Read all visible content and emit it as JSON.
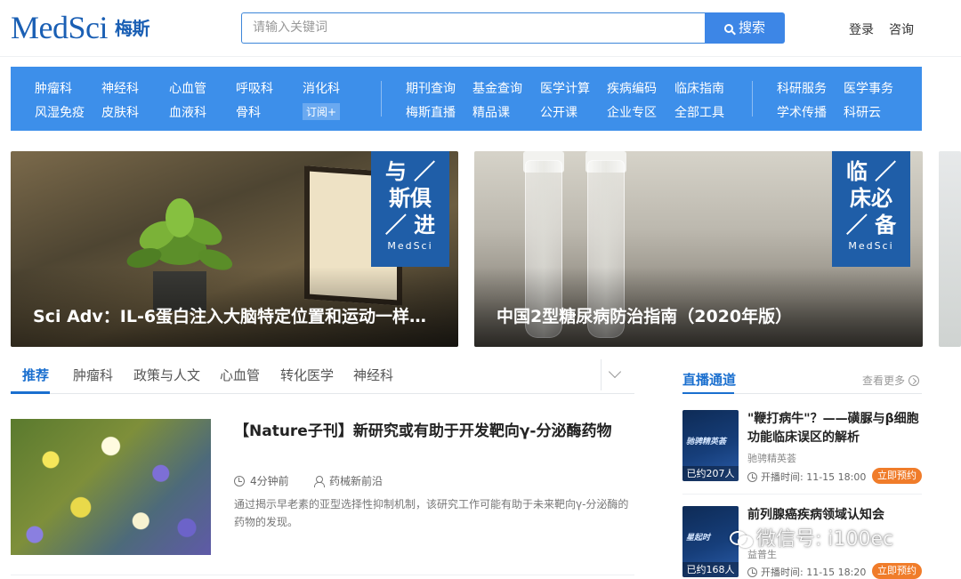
{
  "header": {
    "logo_text": "MedSci",
    "logo_cn": "梅斯",
    "search_placeholder": "请输入关键词",
    "search_button": "搜索",
    "login": "登录",
    "consult": "咨询"
  },
  "nav": {
    "departments_row1": [
      "肿瘤科",
      "神经科",
      "心血管",
      "呼吸科",
      "消化科"
    ],
    "departments_row2": [
      "风湿免疫",
      "皮肤科",
      "血液科",
      "骨科"
    ],
    "subscribe": "订阅+",
    "tools_row1": [
      "期刊查询",
      "基金查询",
      "医学计算",
      "疾病编码",
      "临床指南"
    ],
    "tools_row2": [
      "梅斯直播",
      "精品课",
      "公开课",
      "企业专区",
      "全部工具"
    ],
    "services_row1": [
      "科研服务",
      "医学事务"
    ],
    "services_row2": [
      "学术传播",
      "科研云"
    ]
  },
  "banners": [
    {
      "title": "Sci Adv：IL-6蛋白注入大脑特定位置和运动一样…",
      "badge_lines": [
        "与 ／",
        "斯俱",
        "／ 进"
      ],
      "badge_brand": "MedSci"
    },
    {
      "title": "中国2型糖尿病防治指南（2020年版）",
      "badge_lines": [
        "临 ／",
        "床必",
        "／ 备"
      ],
      "badge_brand": "MedSci"
    }
  ],
  "tabs": [
    "推荐",
    "肿瘤科",
    "政策与人文",
    "心血管",
    "转化医学",
    "神经科"
  ],
  "article": {
    "title": "【Nature子刊】新研究或有助于开发靶向γ-分泌酶药物",
    "time": "4分钟前",
    "source": "药械新前沿",
    "summary": "通过揭示早老素的亚型选择性抑制机制，该研究工作可能有助于未来靶向γ-分泌酶的药物的发现。"
  },
  "live": {
    "title": "直播通道",
    "more": "查看更多",
    "cards": [
      {
        "title": "\"鞭打病牛\"？——磺脲与β细胞功能临床误区的解析",
        "subtitle": "驰骋精英荟",
        "thumb_text": "驰骋精英荟",
        "count": "已约207人",
        "time": "开播时间: 11-15 18:00",
        "button": "立即预约"
      },
      {
        "title": "前列腺癌疾病领域认知会",
        "subtitle": "益普生",
        "thumb_text": "星起时",
        "count": "已约168人",
        "time": "开播时间: 11-15 18:20",
        "button": "立即预约"
      }
    ]
  },
  "watermark": "微信号: i100ec"
}
